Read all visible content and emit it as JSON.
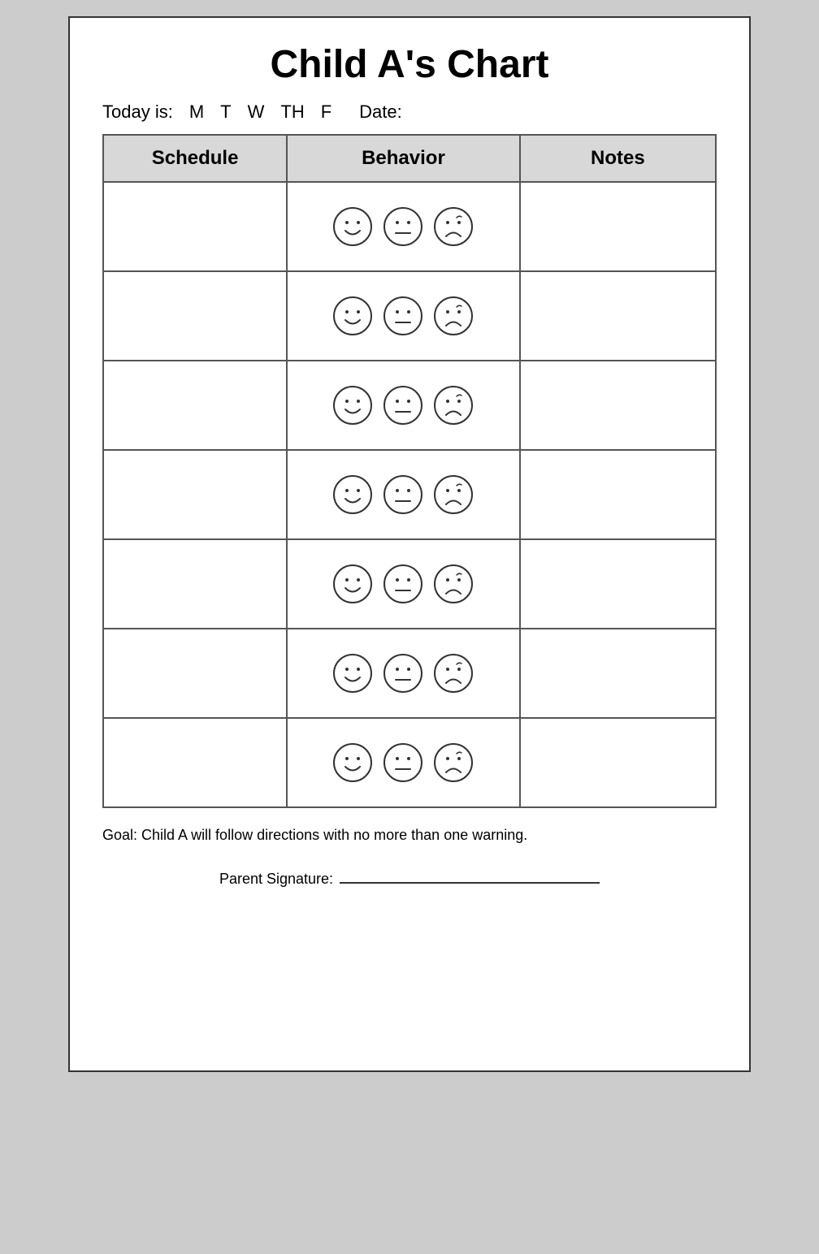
{
  "page": {
    "title": "Child A's Chart",
    "today_label": "Today is:",
    "days": [
      "M",
      "T",
      "W",
      "TH",
      "F"
    ],
    "date_label": "Date:",
    "table": {
      "headers": [
        "Schedule",
        "Behavior",
        "Notes"
      ],
      "rows": 7
    },
    "goal_text": "Goal: Child A will follow directions with no more than one warning.",
    "signature_label": "Parent Signature:",
    "signature_line": "___________________________________"
  }
}
